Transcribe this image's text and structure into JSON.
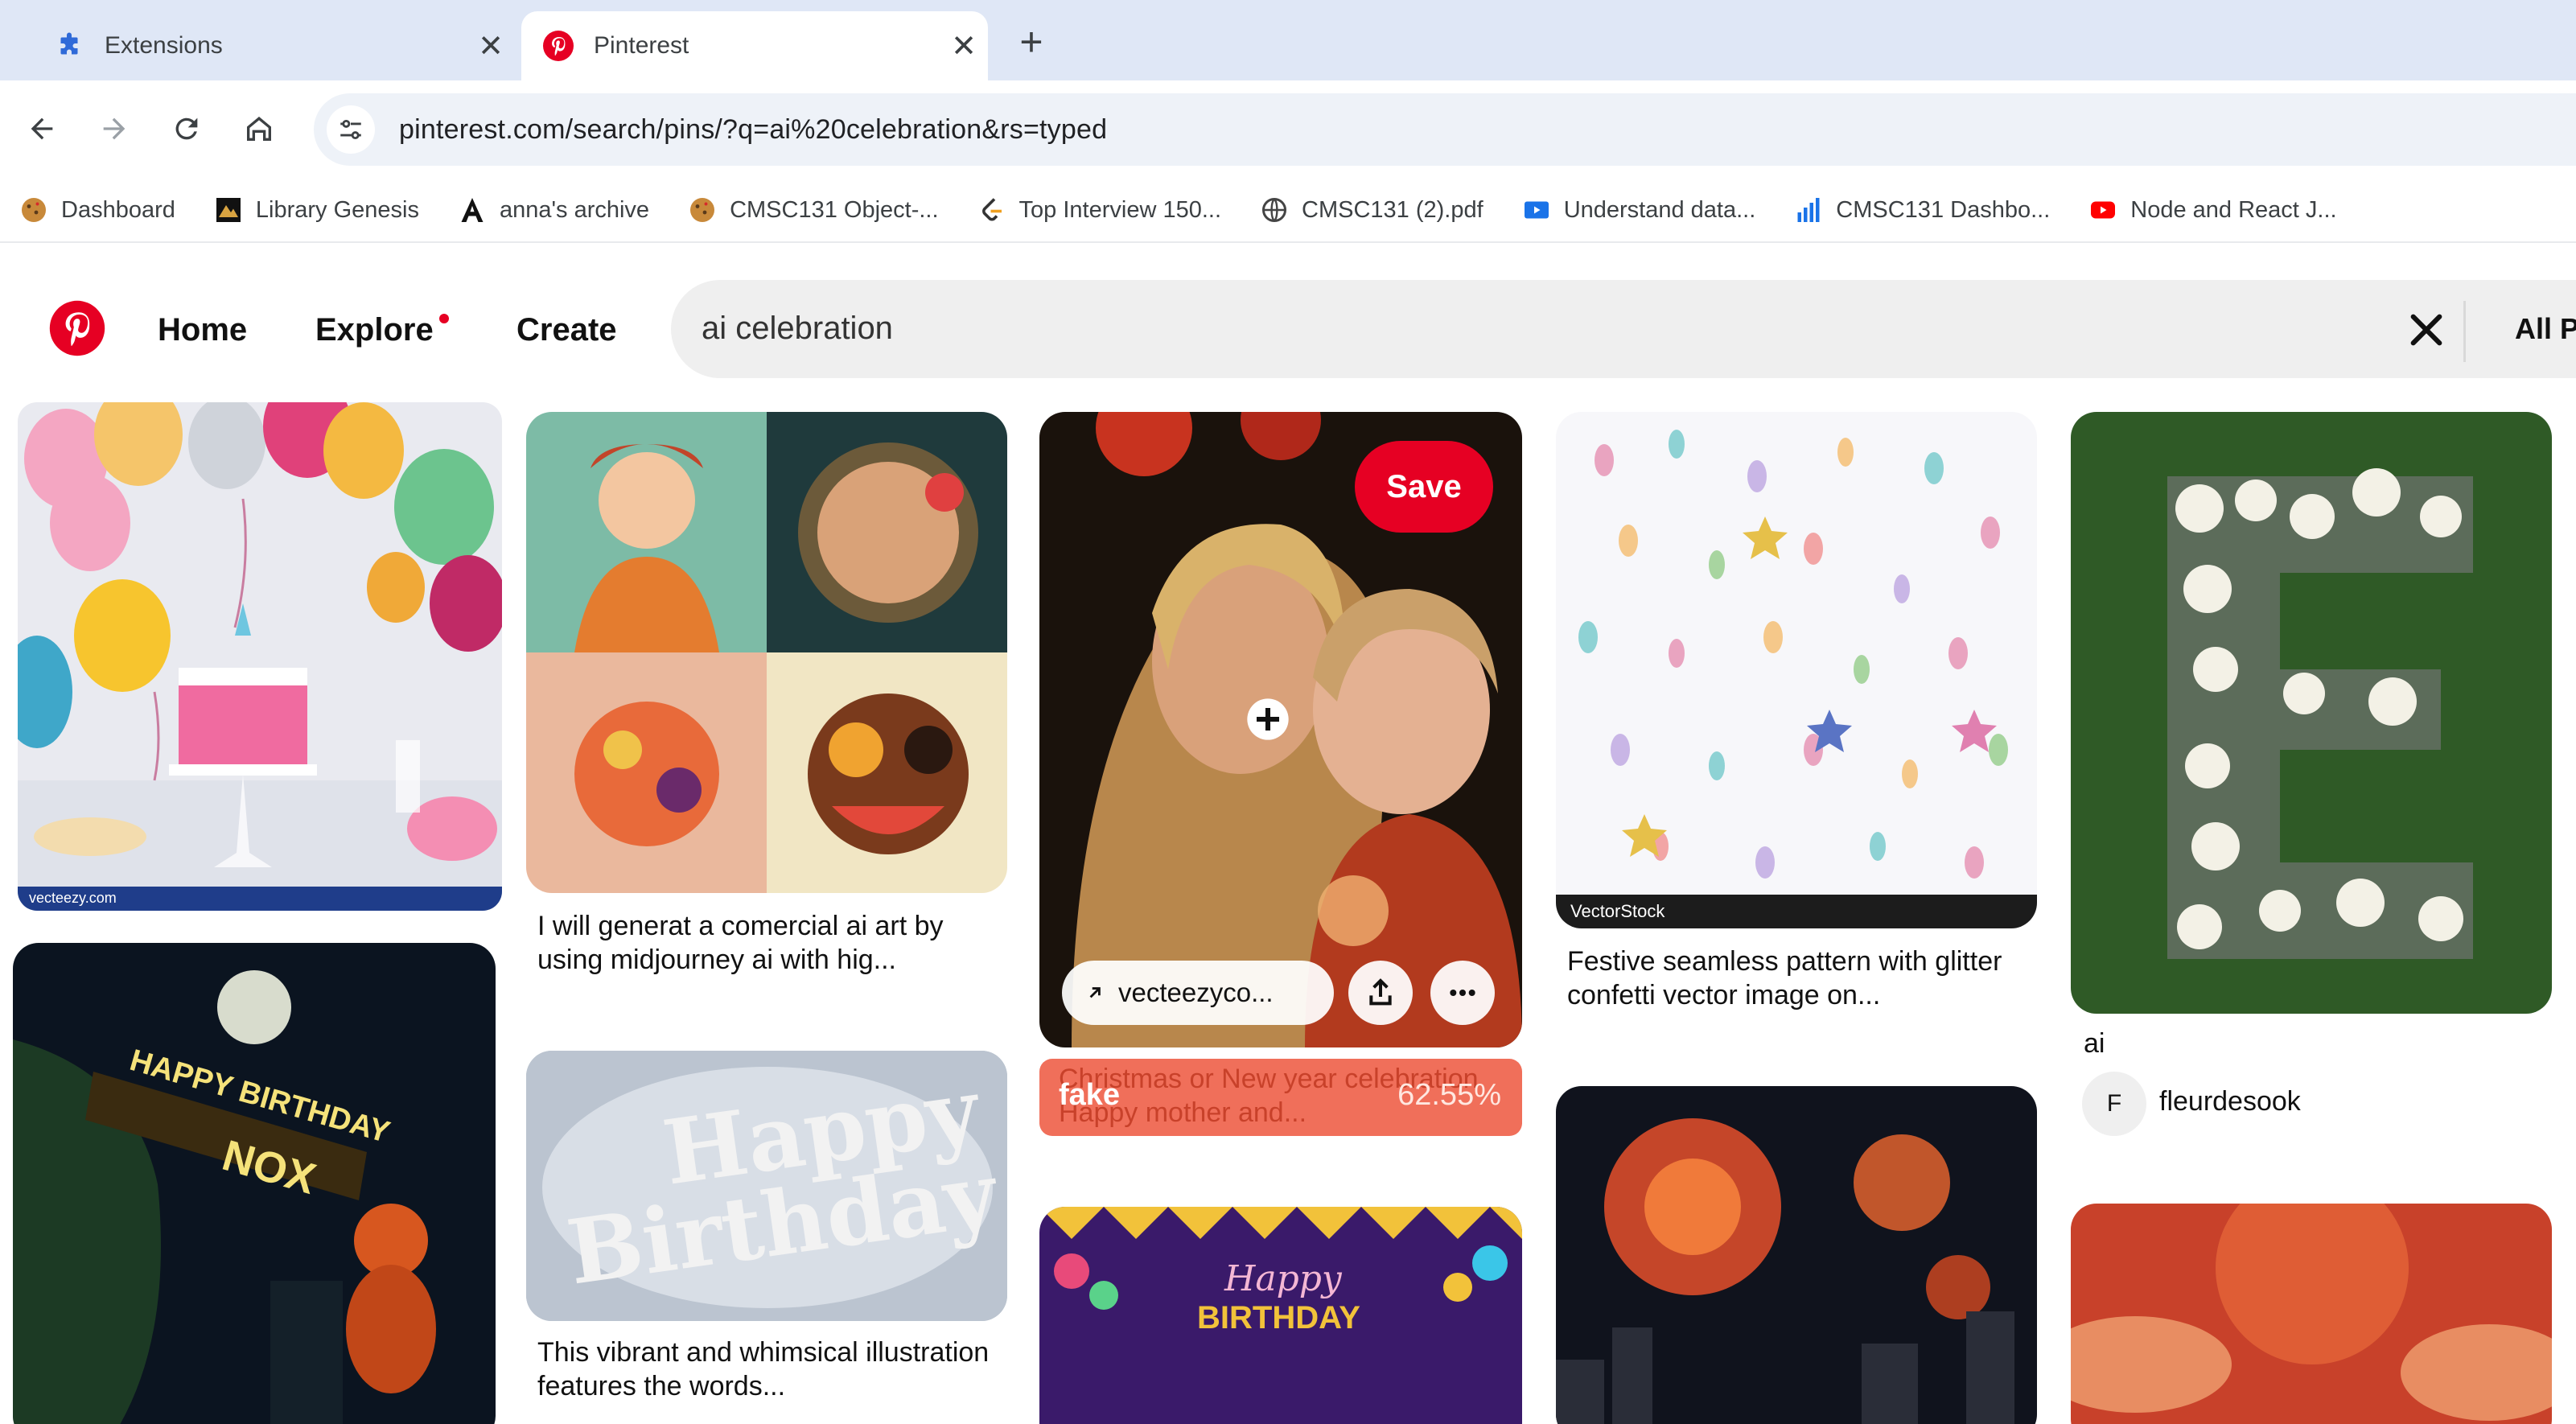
{
  "browser": {
    "tabs": [
      {
        "title": "Extensions",
        "icon": "puzzle-icon",
        "active": false
      },
      {
        "title": "Pinterest",
        "icon": "pinterest-logo-icon",
        "active": true
      }
    ],
    "close_glyph": "✕",
    "new_tab_glyph": "+",
    "url": "pinterest.com/search/pins/?q=ai%20celebration&rs=typed",
    "bookmarks": [
      {
        "label": "Dashboard",
        "icon": "cookie-icon"
      },
      {
        "label": "Library Genesis",
        "icon": "libgen-icon"
      },
      {
        "label": "anna's archive",
        "icon": "letter-a-icon"
      },
      {
        "label": "CMSC131 Object-...",
        "icon": "cookie-icon"
      },
      {
        "label": "Top Interview 150...",
        "icon": "leetcode-icon"
      },
      {
        "label": "CMSC131 (2).pdf",
        "icon": "globe-icon"
      },
      {
        "label": "Understand data...",
        "icon": "video-icon"
      },
      {
        "label": "CMSC131 Dashbo...",
        "icon": "bar-chart-icon"
      },
      {
        "label": "Node and React J...",
        "icon": "youtube-icon"
      }
    ]
  },
  "pinterest": {
    "nav": {
      "home": "Home",
      "explore": "Explore",
      "create": "Create"
    },
    "search": {
      "query": "ai celebration",
      "filter_label": "All P"
    },
    "pins": {
      "p2_caption": "I will generat a comercial ai art by using midjourney ai with hig...",
      "p3_save": "Save",
      "p3_link": "vecteezyco...",
      "p3_title_under": "Christmas or New year celebration Happy mother and...",
      "p3_fake_label": "fake",
      "p3_fake_score": "62.55%",
      "p4_caption": "Festive seamless pattern with glitter confetti vector image on...",
      "p4_watermark": "VectorStock",
      "p5_title": "ai",
      "p5_avatar": "F",
      "p5_author": "fleurdesook",
      "p7_caption": "This vibrant and whimsical illustration features the words...",
      "p7_art_text_1": "Happy",
      "p7_art_text_2": "Birthday",
      "p8_art_text_1": "Happy",
      "p8_art_text_2": "BIRTHDAY",
      "p6_art_text_1": "HAPPY BIRTHDAY",
      "p6_art_text_2": "NOX",
      "p1_watermark_left": "vecteezy.com"
    },
    "colors": {
      "brand": "#e60023",
      "fake_bar": "#f06f5a"
    }
  }
}
